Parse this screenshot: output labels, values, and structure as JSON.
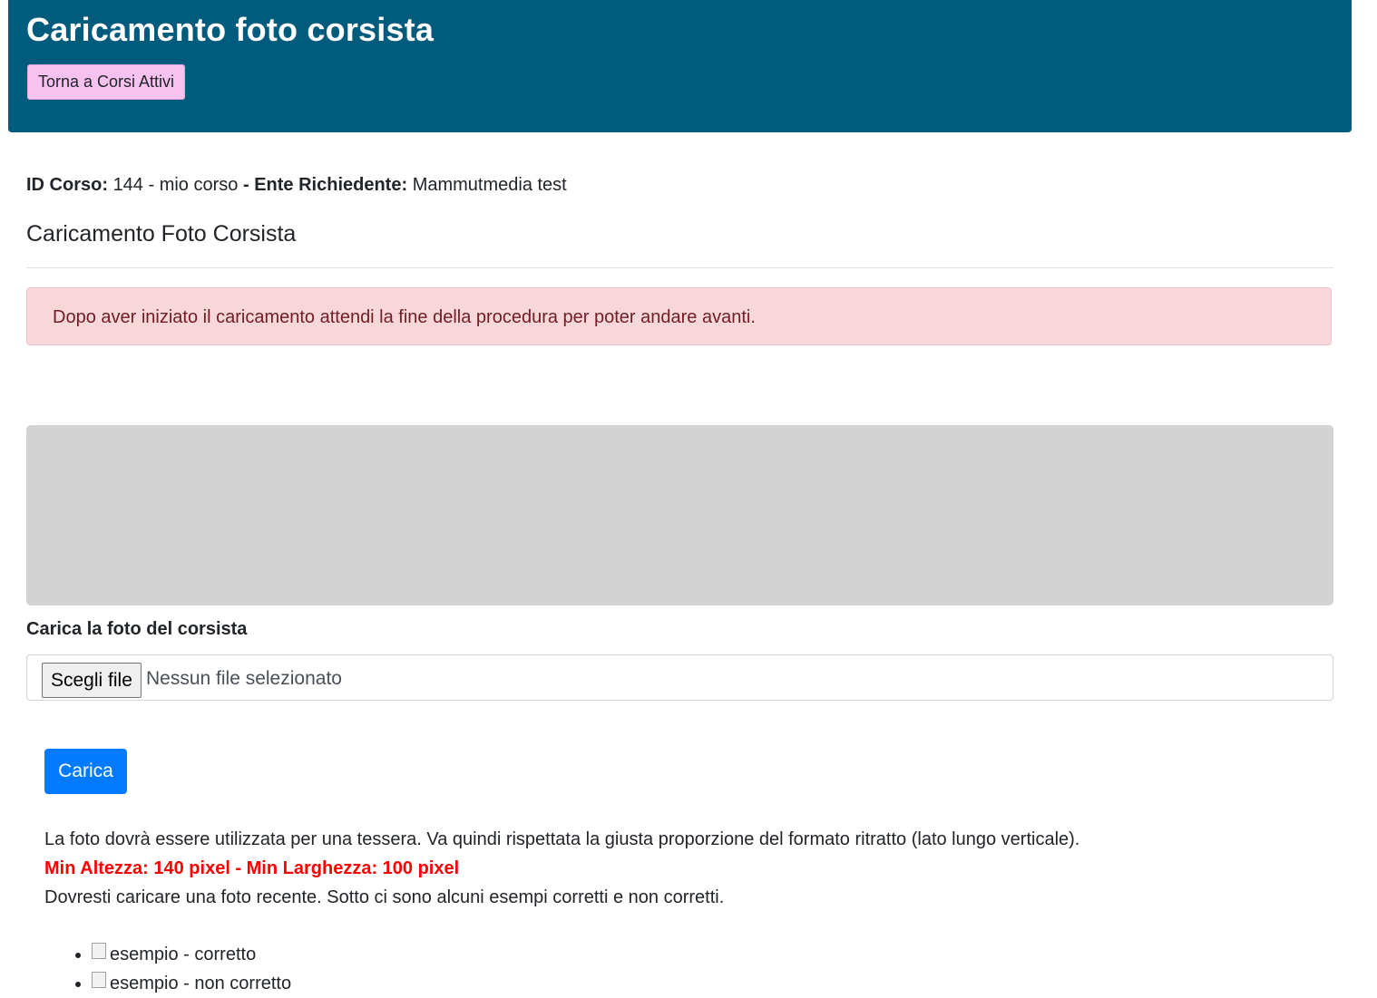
{
  "header": {
    "title": "Caricamento foto corsista",
    "back_button": "Torna a Corsi Attivi",
    "background": "#005b7d"
  },
  "course": {
    "id_label": "ID Corso:",
    "id_value": "144 - mio corso",
    "separator": "-",
    "ente_label": "Ente Richiedente:",
    "ente_value": "Mammutmedia test"
  },
  "section": {
    "title": "Caricamento Foto Corsista"
  },
  "alert": {
    "text": "Dopo aver iniziato il caricamento attendi la fine della procedura per poter andare avanti.",
    "color": "#f8d7da"
  },
  "upload": {
    "label": "Carica la foto del corsista",
    "choose_button": "Scegli file",
    "status": "Nessun file selezionato",
    "submit": "Carica",
    "submit_color": "#007bff"
  },
  "instructions": {
    "line1": "La foto dovrà essere utilizzata per una tessera. Va quindi rispettata la giusta proporzione del formato ritratto (lato lungo verticale).",
    "requirements": "Min Altezza: 140 pixel - Min Larghezza: 100 pixel",
    "line3": "Dovresti caricare una foto recente. Sotto ci sono alcuni esempi corretti e non corretti."
  },
  "examples": [
    {
      "alt": "esempio",
      "caption": " - corretto"
    },
    {
      "alt": "esempio",
      "caption": " - non corretto"
    }
  ]
}
